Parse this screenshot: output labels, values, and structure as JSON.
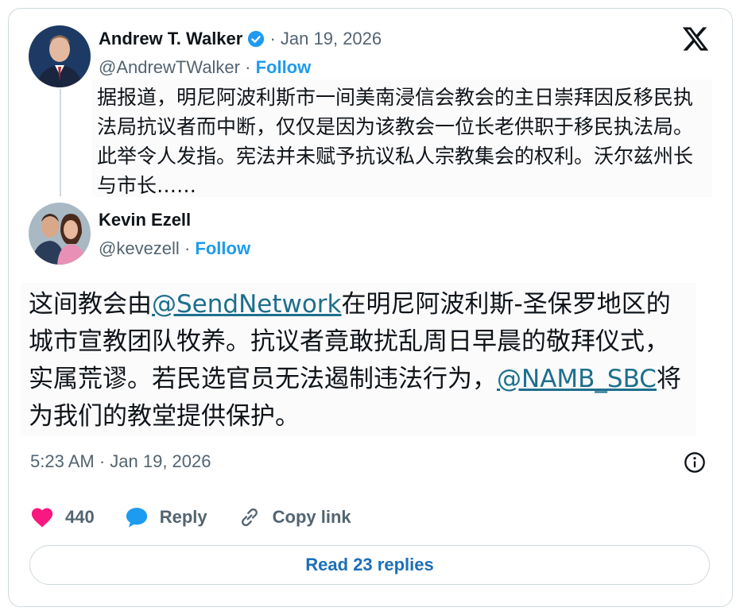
{
  "quoted_tweet": {
    "author_name": "Andrew T. Walker",
    "separator": "·",
    "date": "Jan 19, 2026",
    "handle": "@AndrewTWalker",
    "follow_label": "Follow",
    "text": "据报道，明尼阿波利斯市一间美南浸信会教会的主日崇拜因反移民执法局抗议者而中断，仅仅是因为该教会一位长老供职于移民执法局。此举令人发指。宪法并未赋予抗议私人宗教集会的权利。沃尔兹州长与市长……"
  },
  "tweet": {
    "author_name": "Kevin Ezell",
    "handle": "@kevezell",
    "separator": "·",
    "follow_label": "Follow",
    "text_part1": "这间教会由",
    "mention1": "@SendNetwork",
    "text_part2": "在明尼阿波利斯-圣保罗地区的城市宣教团队牧养。抗议者竟敢扰乱周日早晨的敬拜仪式，实属荒谬。若民选官员无法遏制违法行为，",
    "mention2": "@NAMB_SBC",
    "text_part3": "将为我们的教堂提供保护。",
    "timestamp": "5:23 AM · Jan 19, 2026"
  },
  "actions": {
    "like_count": "440",
    "reply_label": "Reply",
    "copy_link_label": "Copy link"
  },
  "read_replies_label": "Read 23 replies",
  "icons": {
    "logo": "x-logo-icon",
    "verified": "verified-badge-icon",
    "like": "heart-icon",
    "reply": "speech-bubble-icon",
    "copy": "link-icon",
    "info": "info-icon"
  },
  "colors": {
    "accent": "#1d9bf0",
    "like": "#f91880",
    "mention": "#1d6f8c",
    "muted": "#536471"
  }
}
